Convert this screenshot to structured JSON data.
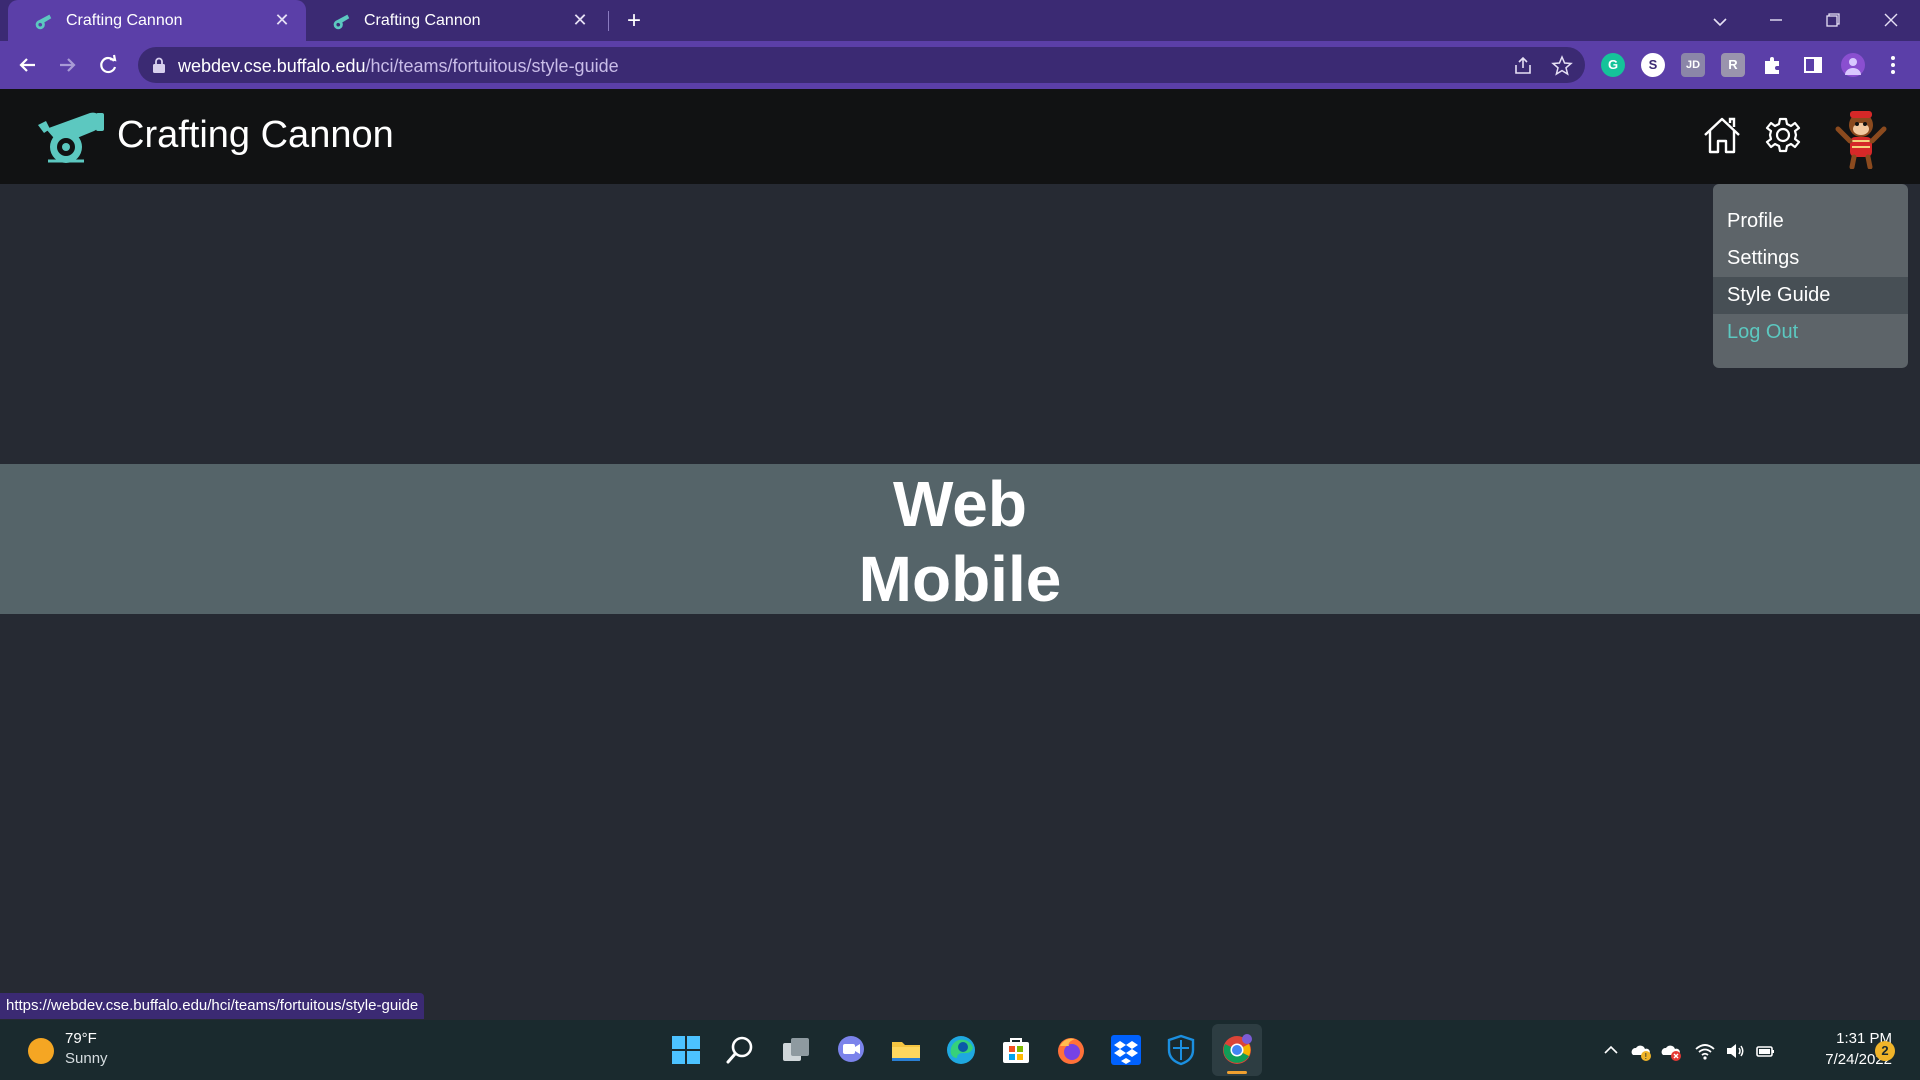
{
  "browser": {
    "tabs": [
      {
        "title": "Crafting Cannon",
        "active": true
      },
      {
        "title": "Crafting Cannon",
        "active": false
      }
    ],
    "address": {
      "host": "webdev.cse.buffalo.edu",
      "path": "/hci/teams/fortuitous/style-guide"
    },
    "extensions": [
      "grammarly-icon",
      "s-extension-icon",
      "jd-extension-icon",
      "r-extension-icon",
      "puzzle-icon",
      "sidepanel-icon",
      "profile-icon",
      "kebab-menu-icon"
    ],
    "status_url": "https://webdev.cse.buffalo.edu/hci/teams/fortuitous/style-guide"
  },
  "app": {
    "title": "Crafting Cannon",
    "accent": "#5cc8c0",
    "banner_lines": [
      "Web",
      "Mobile"
    ],
    "menu": {
      "items": [
        {
          "label": "Profile"
        },
        {
          "label": "Settings"
        },
        {
          "label": "Style Guide",
          "active": true
        },
        {
          "label": "Log Out",
          "accent": true
        }
      ]
    }
  },
  "taskbar": {
    "weather": {
      "temp": "79°F",
      "condition": "Sunny"
    },
    "apps": [
      "start-icon",
      "search-icon",
      "task-view-icon",
      "chat-icon",
      "file-explorer-icon",
      "edge-icon",
      "store-icon",
      "firefox-icon",
      "dropbox-icon",
      "defender-icon",
      "chrome-icon"
    ],
    "clock": {
      "time": "1:31 PM",
      "date": "7/24/2022"
    },
    "notifications": "2"
  }
}
